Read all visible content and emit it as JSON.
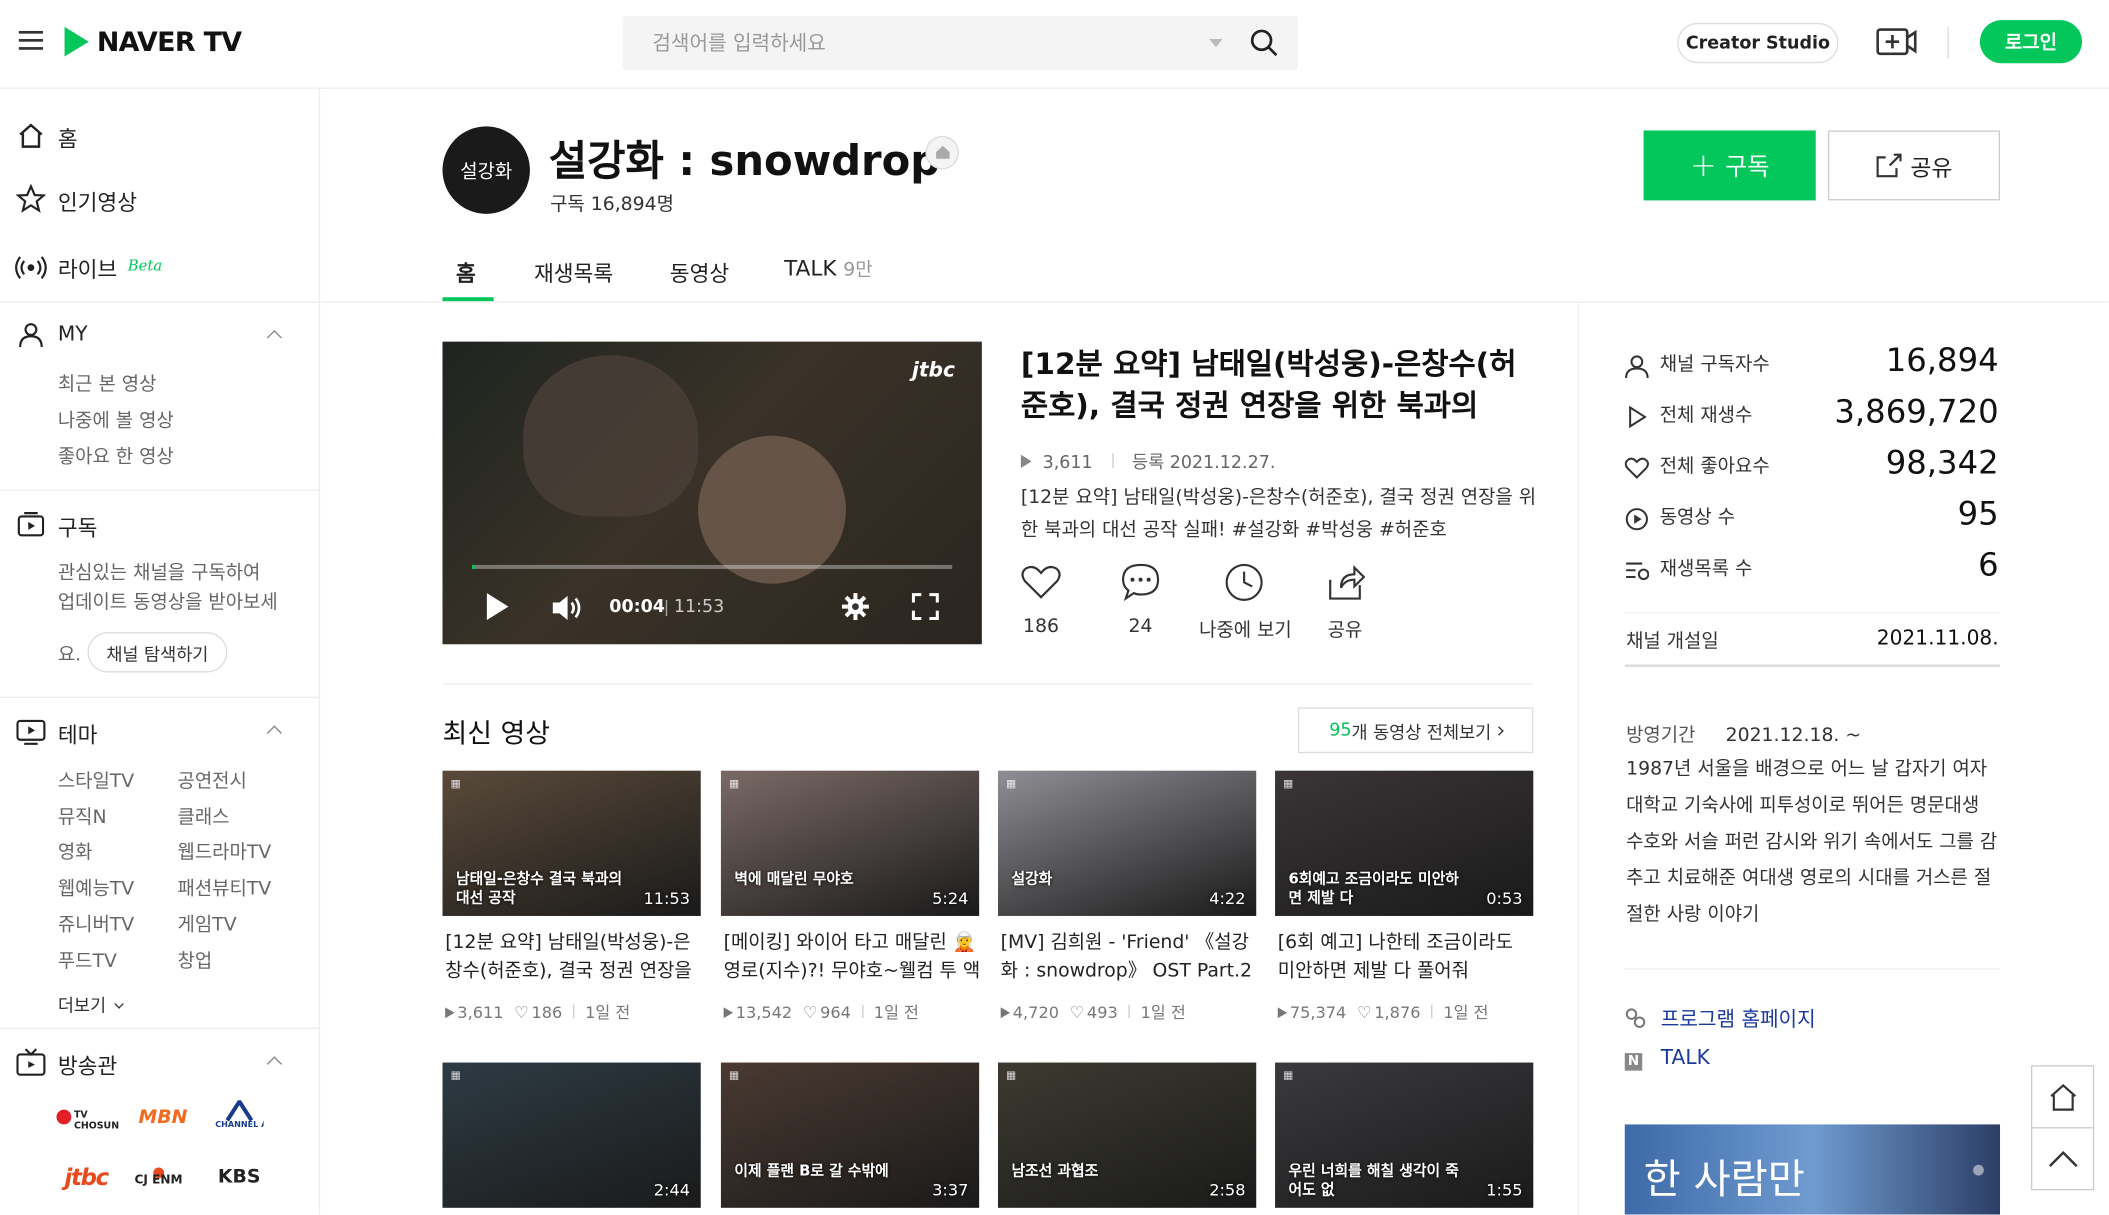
{
  "header": {
    "logo_text": "NAVER TV",
    "search_placeholder": "검색어를 입력하세요",
    "creator_studio": "Creator Studio",
    "login": "로그인",
    "colors": {
      "brand": "#03c75a"
    }
  },
  "sidebar": {
    "home": "홈",
    "popular": "인기영상",
    "live": "라이브",
    "live_beta": "Beta",
    "my": "MY",
    "my_items": [
      "최근 본 영상",
      "나중에 볼 영상",
      "좋아요 한 영상"
    ],
    "subscribe": "구독",
    "subscribe_desc1": "관심있는 채널을 구독하여",
    "subscribe_desc2": "업데이트 동영상을 받아보세",
    "subscribe_desc3": "요.",
    "explore_btn": "채널 탐색하기",
    "theme": "테마",
    "theme_items": [
      "스타일TV",
      "공연전시",
      "뮤직N",
      "클래스",
      "영화",
      "웹드라마TV",
      "웹예능TV",
      "패션뷰티TV",
      "쥬니버TV",
      "게임TV",
      "푸드TV",
      "창업"
    ],
    "more": "더보기",
    "broadcast": "방송관",
    "broadcasters": [
      "TV CHOSUN",
      "MBN",
      "CHANNEL A",
      "jtbc",
      "CJ ENM",
      "KBS"
    ]
  },
  "channel": {
    "avatar_text": "설강화",
    "name": "설강화 : snowdrop",
    "subscribers": "구독 16,894명",
    "subscribe_btn": "구독",
    "share_btn": "공유",
    "tabs": [
      "홈",
      "재생목록",
      "동영상",
      "TALK"
    ],
    "talk_count": "9만"
  },
  "featured": {
    "watermark": "jtbc",
    "time_current": "00:04",
    "time_total": "11:53",
    "progress": 0.006,
    "title": "[12분 요약] 남태일(박성웅)-은창수(허준호), 결국 정권 연장을 위한 북과의",
    "views": "3,611",
    "date_label": "등록 2021.12.27.",
    "desc": "[12분 요약] 남태일(박성웅)-은창수(허준호), 결국 정권 연장을 위한 북과의 대선 공작 실패! #설강화 #박성웅 #허준호",
    "actions": [
      {
        "icon": "heart-icon",
        "label": "186"
      },
      {
        "icon": "comment-icon",
        "label": "24"
      },
      {
        "icon": "clock-icon",
        "label": "나중에 보기"
      },
      {
        "icon": "share-icon",
        "label": "공유"
      }
    ]
  },
  "stats": {
    "rows": [
      {
        "icon": "person-icon",
        "label": "채널 구독자수",
        "value": "16,894"
      },
      {
        "icon": "play-icon",
        "label": "전체 재생수",
        "value": "3,869,720"
      },
      {
        "icon": "heart-icon",
        "label": "전체 좋아요수",
        "value": "98,342"
      },
      {
        "icon": "video-count-icon",
        "label": "동영상 수",
        "value": "95"
      },
      {
        "icon": "playlist-icon",
        "label": "재생목록 수",
        "value": "6"
      }
    ],
    "opened_label": "채널 개설일",
    "opened_value": "2021.11.08.",
    "broadcast_label": "방영기간",
    "broadcast_value": "2021.12.18. ~",
    "synopsis": "1987년 서울을 배경으로 어느 날 갑자기 여자대학교 기숙사에 피투성이로 뛰어든 명문대생 수호와 서슬 퍼런 감시와 위기 속에서도 그를 감추고 치료해준 여대생 영로의 시대를 거스른 절절한 사랑 이야기",
    "program_link": "프로그램 홈페이지",
    "talk_link": "TALK",
    "banner_text": "한 사람만"
  },
  "latest": {
    "title": "최신 영상",
    "count": "95",
    "view_all": "개 동영상 전체보기",
    "videos": [
      {
        "duration": "11:53",
        "title": "[12분 요약] 남태일(박성웅)-은창수(허준호), 결국 정권 연장을 위한 북과의",
        "views": "3,611",
        "likes": "186",
        "ago": "1일 전",
        "caption": "남태일-은창수 결국 북과의 대선 공작",
        "bg": "#5a4a3a"
      },
      {
        "duration": "5:24",
        "title": "[메이킹] 와이어 타고 매달린 🧝 영로(지수)?! 무야호~웰컴 투 액션의 세계",
        "views": "13,542",
        "likes": "964",
        "ago": "1일 전",
        "caption": "벽에 매달린 무야호",
        "bg": "#7a6a66"
      },
      {
        "duration": "4:22",
        "title": "[MV] 김희원 - 'Friend' 《설강화 : snowdrop》 OST Part.2",
        "views": "4,720",
        "likes": "493",
        "ago": "1일 전",
        "caption": "설강화",
        "bg": "#8e8e94"
      },
      {
        "duration": "0:53",
        "title": "[6회 예고] 나한테 조금이라도 미안하면 제발 다 풀어줘",
        "views": "75,374",
        "likes": "1,876",
        "ago": "1일 전",
        "caption": "6회예고 조금이라도 미안하면 제발 다",
        "bg": "#3a3536"
      },
      {
        "duration": "2:44",
        "caption": "",
        "bg": "#2d3b44"
      },
      {
        "duration": "3:37",
        "caption": "이제 플랜 B로 갈 수밖에",
        "bg": "#4a3a32"
      },
      {
        "duration": "2:58",
        "caption": "남조선 과협조",
        "bg": "#3c3a30"
      },
      {
        "duration": "1:55",
        "caption": "우린 너희를 해칠 생각이 죽어도 없",
        "bg": "#3a3a3e"
      }
    ]
  }
}
